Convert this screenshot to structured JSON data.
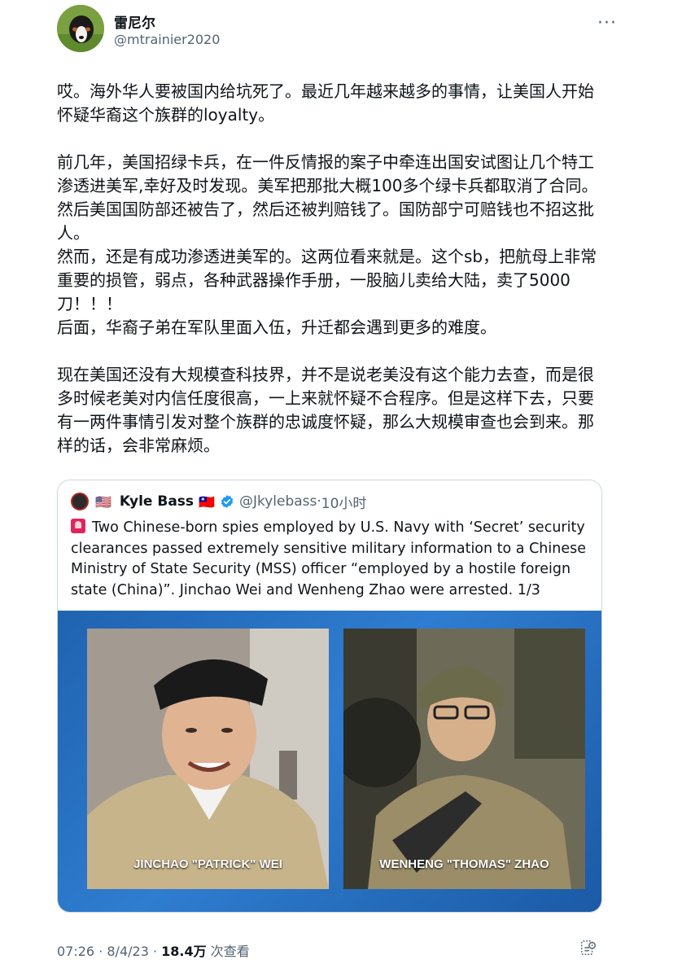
{
  "author": {
    "name": "雷尼尔",
    "handle": "@mtrainier2020"
  },
  "more_icon": "more-dots-icon",
  "body": {
    "p1": "哎。海外华人要被国内给坑死了。最近几年越来越多的事情，让美国人开始怀疑华裔这个族群的loyalty。",
    "p2": "前几年，美国招绿卡兵，在一件反情报的案子中牵连出国安试图让几个特工渗透进美军,幸好及时发现。美军把那批大概100多个绿卡兵都取消了合同。然后美国国防部还被告了，然后还被判赔钱了。国防部宁可赔钱也不招这批人。",
    "p3": "然而，还是有成功渗透进美军的。这两位看来就是。这个sb，把航母上非常重要的损管，弱点，各种武器操作手册，一股脑儿卖给大陆，卖了5000刀！！！",
    "p4": "后面，华裔子弟在军队里面入伍，升迁都会遇到更多的难度。",
    "p5": "现在美国还没有大规模查科技界，并不是说老美没有这个能力去查，而是很多时候老美对内信任度很高，一上来就怀疑不合程序。但是这样下去，只要有一两件事情引发对整个族群的忠诚度怀疑，那么大规模审查也会到来。那样的话，会非常麻烦。"
  },
  "quote": {
    "flag_us": "🇺🇸",
    "name": "Kyle Bass",
    "flag_tw": "🇹🇼",
    "handle": "@Jkylebass",
    "separator": "·",
    "time": "10小时",
    "text": "Two Chinese-born spies employed by U.S. Navy with ‘Secret’ security clearances passed extremely sensitive military information to a Chinese Ministry of State Security (MSS) officer “employed by a hostile foreign state (China)”. Jinchao Wei and Wenheng Zhao were arrested. 1/3",
    "media": {
      "left_caption": "JINCHAO \"PATRICK\" WEI",
      "right_caption": "WENHENG \"THOMAS\" ZHAO"
    }
  },
  "footer": {
    "time": "07:26",
    "dot1": " · ",
    "date": "8/4/23",
    "dot2": " · ",
    "views": "18.4万",
    "views_label": " 次查看"
  },
  "colors": {
    "text": "#0f1419",
    "secondary": "#536471",
    "verified": "#1d9bf0",
    "media_bg": "#1f63b0"
  }
}
